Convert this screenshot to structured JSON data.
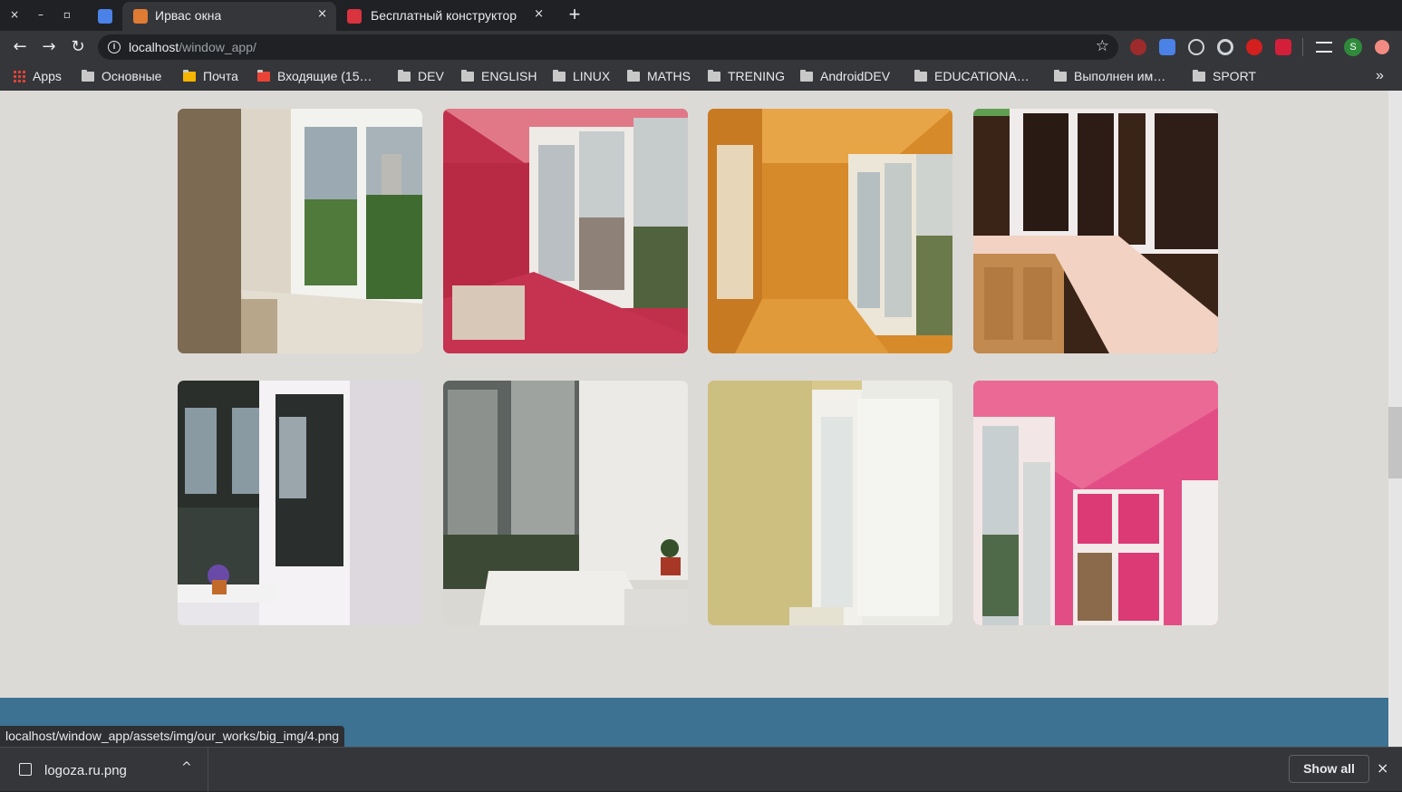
{
  "window_controls": {
    "close": "×",
    "minimize": "–",
    "maximize": "▫"
  },
  "tabs": [
    {
      "title": "Ирвас окна",
      "close": "×"
    },
    {
      "title": "Бесплатный конструктор",
      "close": "×"
    }
  ],
  "new_tab": "+",
  "toolbar": {
    "back": "←",
    "forward": "→",
    "reload": "↻",
    "url_host": "localhost",
    "url_path": "/window_app/",
    "info_icon": "i",
    "star": "☆",
    "profile_initial": "S"
  },
  "bookmarks": {
    "apps_label": "Apps",
    "items": [
      "Основные",
      "Почта",
      "Входящие (15…",
      "DEV",
      "ENGLISH",
      "LINUX",
      "MATHS",
      "TRENING",
      "AndroidDEV",
      "EDUCATIONA…",
      "Выполнен им…",
      "SPORT"
    ],
    "overflow": "»"
  },
  "gallery": {
    "photos": [
      {
        "name": "Balcony with beige walls and white window frames"
      },
      {
        "name": "Balcony with red walls and sliding windows"
      },
      {
        "name": "Balcony with wooden panelling"
      },
      {
        "name": "Balcony with wooden cabinet and pink countertop"
      },
      {
        "name": "Balcony door with plants on sill"
      },
      {
        "name": "Balcony with white panels and plant"
      },
      {
        "name": "Balcony with yellow wallpaper and white door"
      },
      {
        "name": "Balcony with pink ceiling and cabinets"
      }
    ]
  },
  "status_bar": {
    "link_url": "localhost/window_app/assets/img/our_works/big_img/4.png"
  },
  "downloads": {
    "file_name": "logoza.ru.png",
    "caret": "^",
    "show_all": "Show all",
    "close": "×"
  },
  "colors": {
    "footer_band": "#3d7292",
    "page_bg": "#dcdad6",
    "chrome_dark": "#202124",
    "chrome_toolbar": "#35363a"
  }
}
